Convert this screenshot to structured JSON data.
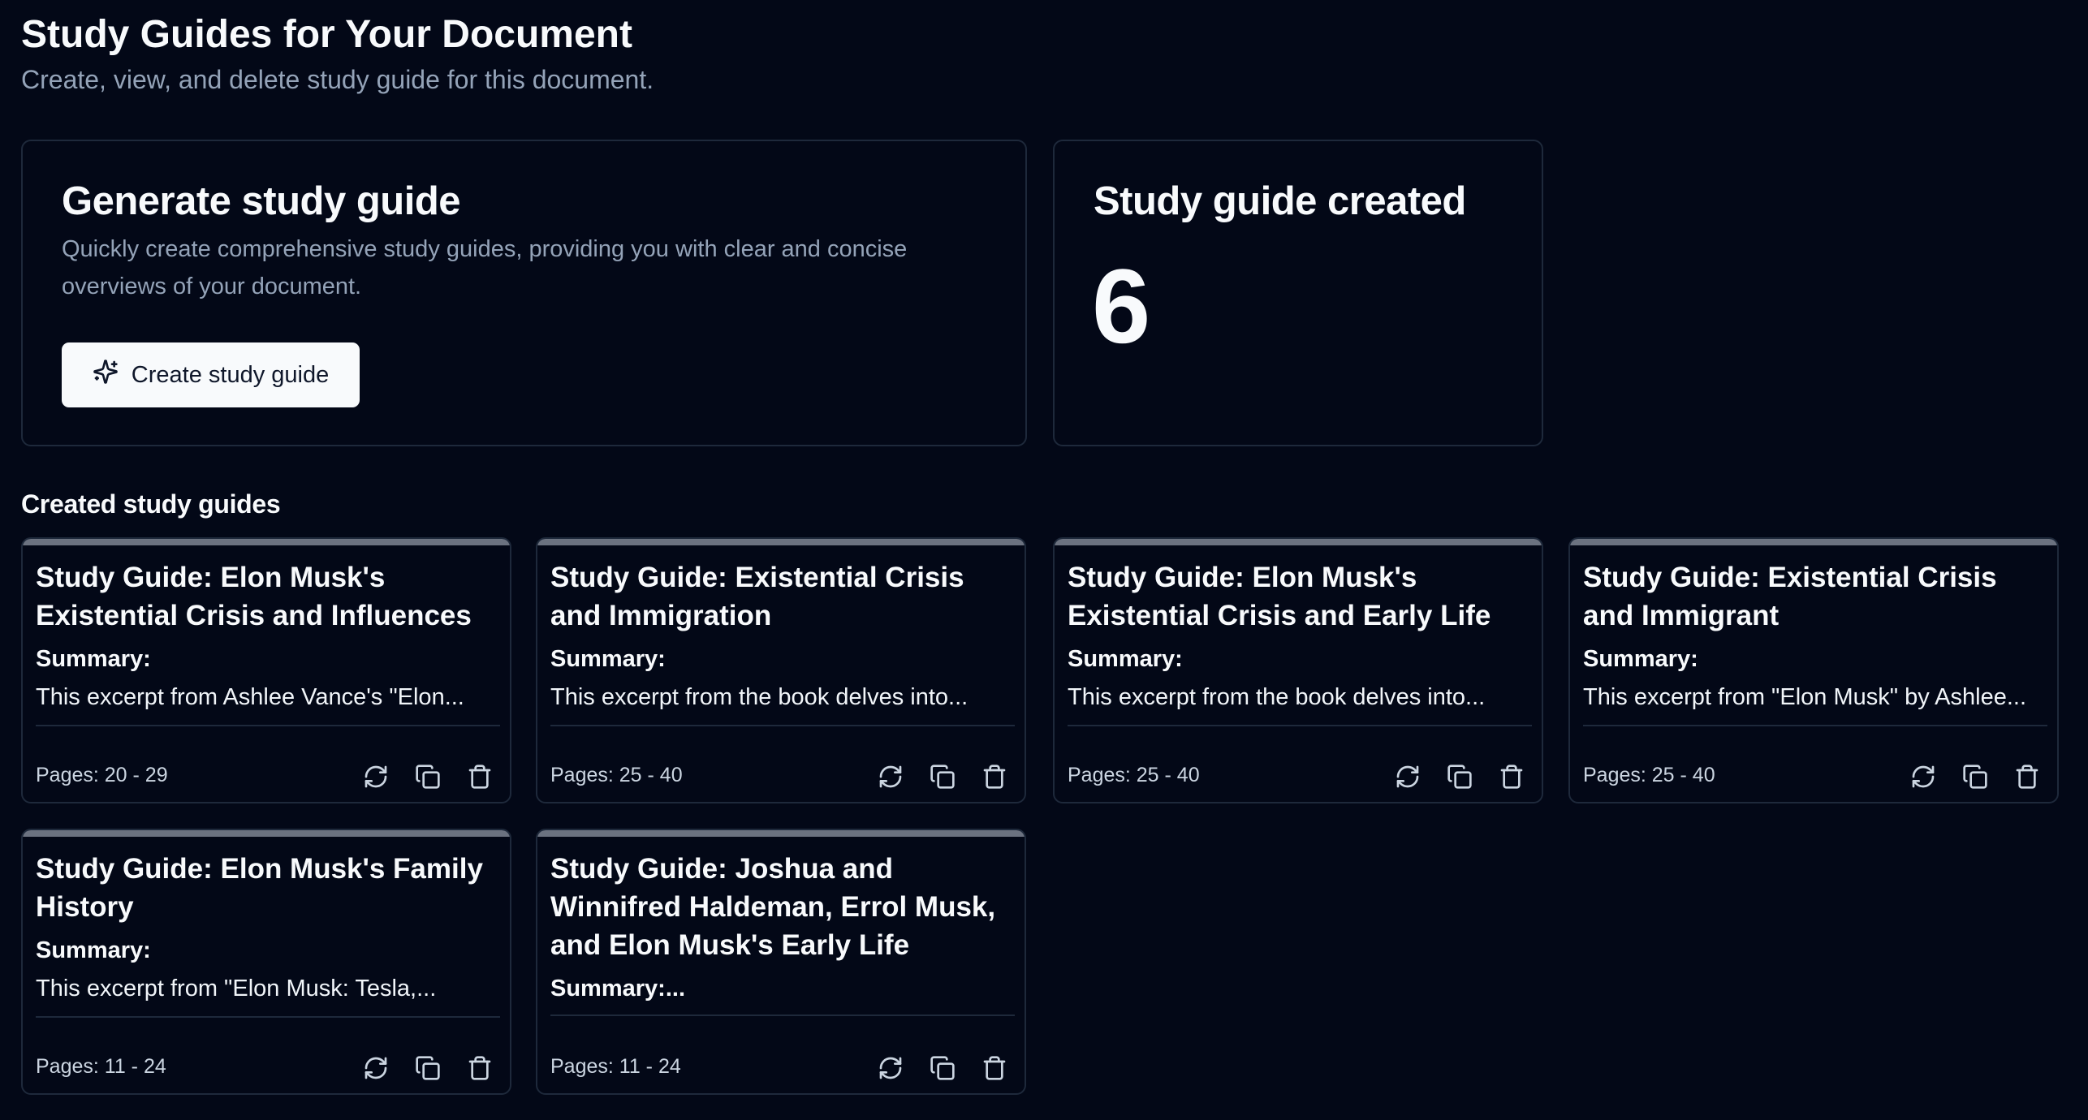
{
  "header": {
    "title": "Study Guides for Your Document",
    "subtitle": "Create, view, and delete study guide for this document."
  },
  "generate": {
    "title": "Generate study guide",
    "description": "Quickly create comprehensive study guides, providing you with clear and concise overviews of your document.",
    "button_label": "Create study guide",
    "button_icon": "sparkles-icon"
  },
  "counter": {
    "title": "Study guide created",
    "value": "6"
  },
  "list": {
    "label": "Created study guides",
    "cards": [
      {
        "title": "Study Guide: Elon Musk's Existential Crisis and Influences",
        "summary_label": "Summary:",
        "summary": "This excerpt from Ashlee Vance's \"Elon...",
        "pages": "Pages: 20 - 29"
      },
      {
        "title": "Study Guide: Existential Crisis and Immigration",
        "summary_label": "Summary:",
        "summary": "This excerpt from the book delves into...",
        "pages": "Pages: 25 - 40"
      },
      {
        "title": "Study Guide: Elon Musk's Existential Crisis and Early Life",
        "summary_label": "Summary:",
        "summary": "This excerpt from the book delves into...",
        "pages": "Pages: 25 - 40"
      },
      {
        "title": "Study Guide: Existential Crisis and Immigrant",
        "summary_label": "Summary:",
        "summary": "This excerpt from \"Elon Musk\" by Ashlee...",
        "pages": "Pages: 25 - 40"
      },
      {
        "title": "Study Guide: Elon Musk's Family History",
        "summary_label": "Summary:",
        "summary": "This excerpt from \"Elon Musk: Tesla,...",
        "pages": "Pages: 11 - 24"
      },
      {
        "title": "Study Guide: Joshua and Winnifred Haldeman, Errol Musk, and Elon Musk's Early Life",
        "summary_label": "Summary:...",
        "summary": "",
        "pages": "Pages: 11 - 24"
      }
    ],
    "action_icons": [
      "refresh-icon",
      "copy-icon",
      "trash-icon"
    ]
  },
  "colors": {
    "background": "#030817",
    "border": "#1e293b",
    "card_top_bar": "#6b7280",
    "muted_text": "#94a3b8",
    "button_bg": "#f8fafc"
  }
}
